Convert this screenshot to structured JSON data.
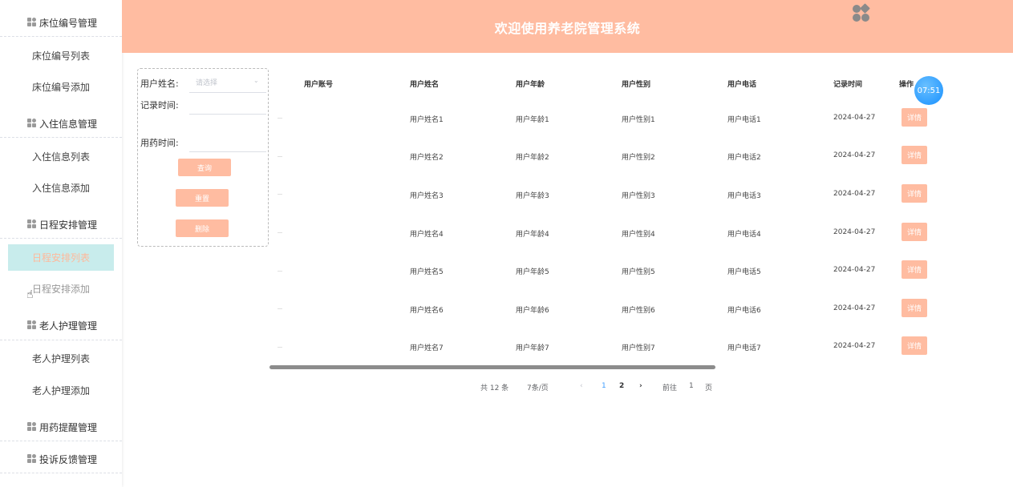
{
  "header": {
    "title": "欢迎使用养老院管理系统",
    "logo_icon": "clover-icon"
  },
  "sidebar": {
    "groups": [
      {
        "label": "床位编号管理"
      },
      {
        "label": "入住信息管理"
      },
      {
        "label": "日程安排管理"
      },
      {
        "label": "老人护理管理"
      },
      {
        "label": "用药提醒管理"
      },
      {
        "label": "投诉反馈管理"
      }
    ],
    "items": [
      {
        "label": "床位编号列表"
      },
      {
        "label": "床位编号添加"
      },
      {
        "label": "入住信息列表"
      },
      {
        "label": "入住信息添加"
      },
      {
        "label": "日程安排列表"
      },
      {
        "label": "日程安排添加"
      },
      {
        "label": "老人护理列表"
      },
      {
        "label": "老人护理添加"
      }
    ],
    "active_item": "日程安排列表"
  },
  "search": {
    "user_name_label": "用户姓名:",
    "user_name_placeholder": "请选择",
    "record_time_label": "记录时间:",
    "med_time_label": "用药时间:",
    "query_button": "查询",
    "reset_button": "重置",
    "delete_button": "删除"
  },
  "table": {
    "headers": [
      "用户账号",
      "用户姓名",
      "用户年龄",
      "用户性别",
      "用户电话",
      "记录时间",
      "操作"
    ],
    "detail_label": "详情",
    "rows": [
      {
        "name": "用户姓名1",
        "age": "用户年龄1",
        "gender": "用户性别1",
        "phone": "用户电话1",
        "time": "2024-04-27"
      },
      {
        "name": "用户姓名2",
        "age": "用户年龄2",
        "gender": "用户性别2",
        "phone": "用户电话2",
        "time": "2024-04-27"
      },
      {
        "name": "用户姓名3",
        "age": "用户年龄3",
        "gender": "用户性别3",
        "phone": "用户电话3",
        "time": "2024-04-27"
      },
      {
        "name": "用户姓名4",
        "age": "用户年龄4",
        "gender": "用户性别4",
        "phone": "用户电话4",
        "time": "2024-04-27"
      },
      {
        "name": "用户姓名5",
        "age": "用户年龄5",
        "gender": "用户性别5",
        "phone": "用户电话5",
        "time": "2024-04-27"
      },
      {
        "name": "用户姓名6",
        "age": "用户年龄6",
        "gender": "用户性别6",
        "phone": "用户电话6",
        "time": "2024-04-27"
      },
      {
        "name": "用户姓名7",
        "age": "用户年龄7",
        "gender": "用户性别7",
        "phone": "用户电话7",
        "time": "2024-04-27"
      }
    ]
  },
  "pagination": {
    "total": "共 12 条",
    "page_size": "7条/页",
    "prev": "‹",
    "pages": [
      "1",
      "2"
    ],
    "next": "›",
    "goto_label": "前往",
    "goto_value": "1",
    "page_unit": "页"
  },
  "clock": {
    "time": "07:51"
  },
  "colors": {
    "accent": "#ffbca1",
    "active_bg": "#c8ecec",
    "clock": "#1890ff"
  }
}
